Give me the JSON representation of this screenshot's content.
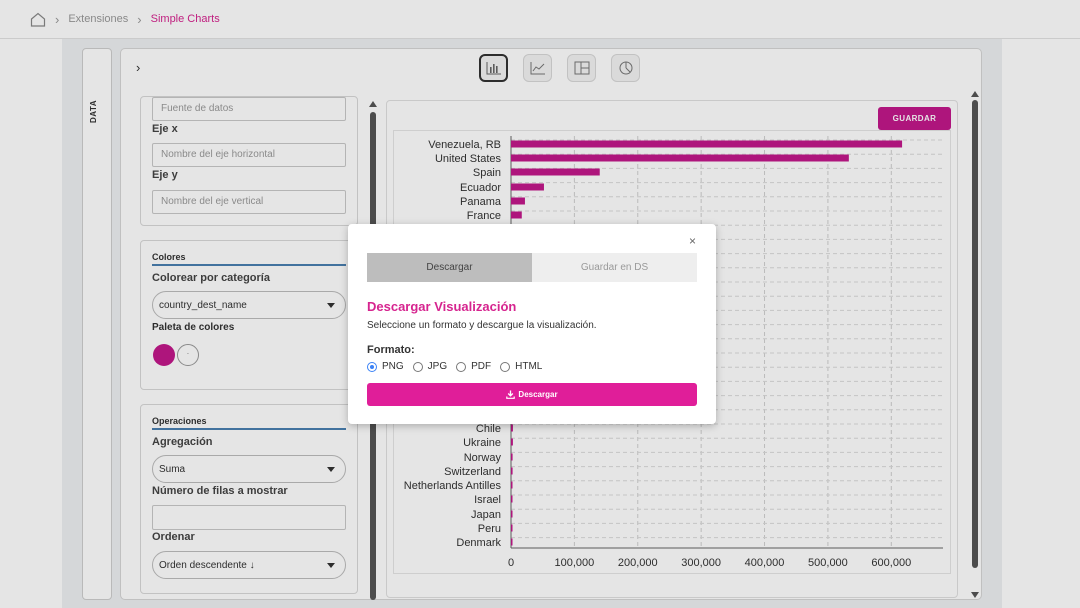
{
  "breadcrumb": {
    "items": [
      "Extensiones",
      "Simple Charts"
    ]
  },
  "side_tab": {
    "label": "DATA"
  },
  "toolbar": {
    "chart_types": [
      "bar-chart-icon",
      "line-chart-icon",
      "treemap-icon",
      "pie-chart-icon"
    ],
    "selected": "bar-chart-icon"
  },
  "fields": {
    "source_placeholder": "Fuente de datos",
    "x_label": "Eje x",
    "x_placeholder": "Nombre del eje horizontal",
    "y_label": "Eje y",
    "y_placeholder": "Nombre del eje vertical"
  },
  "colors": {
    "section_title": "Colores",
    "color_by_label": "Colorear por categoría",
    "color_by_value": "country_dest_name",
    "palette_label": "Paleta de colores",
    "palette": [
      "#c2188b",
      "#ffffff"
    ]
  },
  "operations": {
    "section_title": "Operaciones",
    "aggregation_label": "Agregación",
    "aggregation_value": "Suma",
    "rows_label": "Número de filas a mostrar",
    "rows_value": "",
    "order_label": "Ordenar",
    "order_value": "Orden descendente ↓"
  },
  "save_button": "GUARDAR",
  "modal": {
    "tabs": [
      "Descargar",
      "Guardar en DS"
    ],
    "active_tab": "Descargar",
    "title": "Descargar Visualización",
    "description": "Seleccione un formato y descargue la visualización.",
    "format_label": "Formato:",
    "formats": [
      "PNG",
      "JPG",
      "PDF",
      "HTML"
    ],
    "selected_format": "PNG",
    "download_button": "Descargar",
    "close": "×"
  },
  "chart_data": {
    "type": "bar",
    "orientation": "horizontal",
    "categories": [
      "Venezuela, RB",
      "United States",
      "Spain",
      "Ecuador",
      "Panama",
      "France",
      "Chile",
      "Ukraine",
      "Norway",
      "Switzerland",
      "Netherlands Antilles",
      "Israel",
      "Japan",
      "Peru",
      "Denmark"
    ],
    "values": [
      617000,
      533000,
      140000,
      52000,
      22000,
      17000,
      3000,
      3000,
      2500,
      2500,
      2000,
      1000,
      1000,
      800,
      700
    ],
    "x_ticks": [
      "0",
      "100,000",
      "200,000",
      "300,000",
      "400,000",
      "500,000",
      "600,000"
    ],
    "xlim": [
      0,
      650000
    ],
    "color": "#c2188b",
    "grid": true
  }
}
